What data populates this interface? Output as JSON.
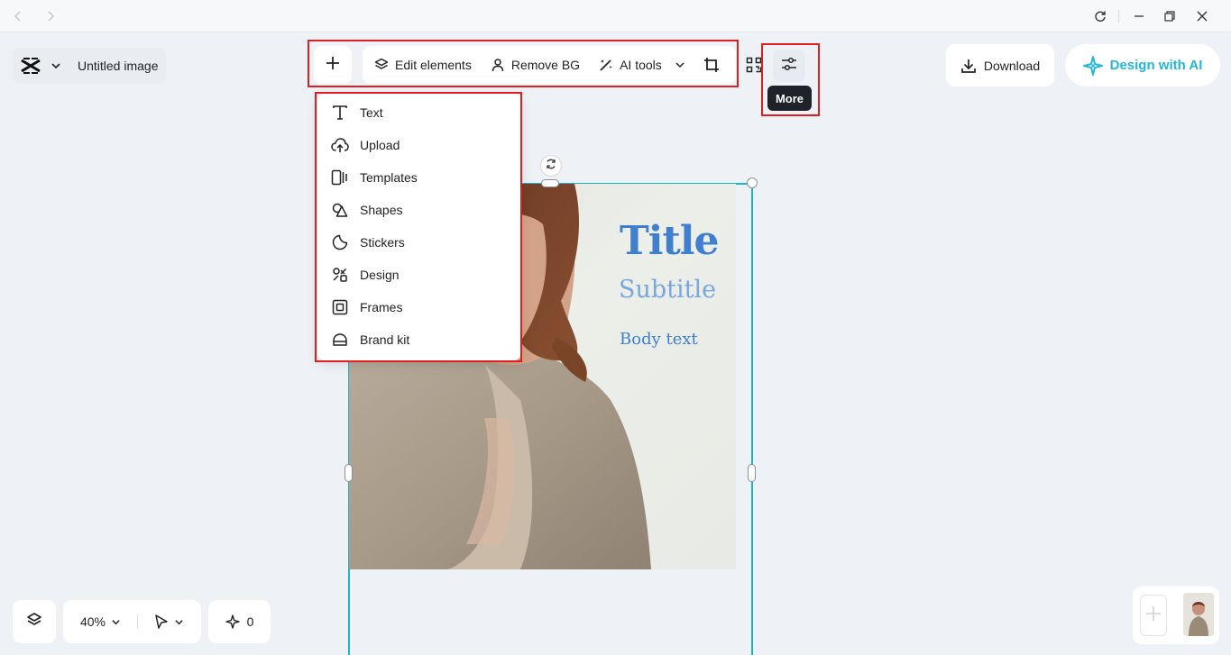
{
  "app": {
    "document_name": "Untitled image"
  },
  "toolbar": {
    "edit_elements": "Edit elements",
    "remove_bg": "Remove BG",
    "ai_tools": "AI tools",
    "more_tooltip": "More"
  },
  "header_right": {
    "download": "Download",
    "design_with_ai": "Design with AI"
  },
  "add_menu": {
    "items": [
      {
        "label": "Text",
        "icon": "text-icon"
      },
      {
        "label": "Upload",
        "icon": "upload-cloud-icon"
      },
      {
        "label": "Templates",
        "icon": "templates-icon"
      },
      {
        "label": "Shapes",
        "icon": "shapes-icon"
      },
      {
        "label": "Stickers",
        "icon": "stickers-icon"
      },
      {
        "label": "Design",
        "icon": "design-icon"
      },
      {
        "label": "Frames",
        "icon": "frames-icon"
      },
      {
        "label": "Brand kit",
        "icon": "brand-kit-icon"
      }
    ]
  },
  "canvas": {
    "title": "Title",
    "subtitle": "Subtitle",
    "body": "Body text"
  },
  "bottom": {
    "zoom": "40%",
    "ai_credits": "0"
  },
  "colors": {
    "accent": "#19b4cf",
    "ai_brand": "#22b7d6",
    "highlight": "#e01e1e",
    "title_blue": "#3f7fce",
    "subtitle_blue": "#7aa6de"
  }
}
